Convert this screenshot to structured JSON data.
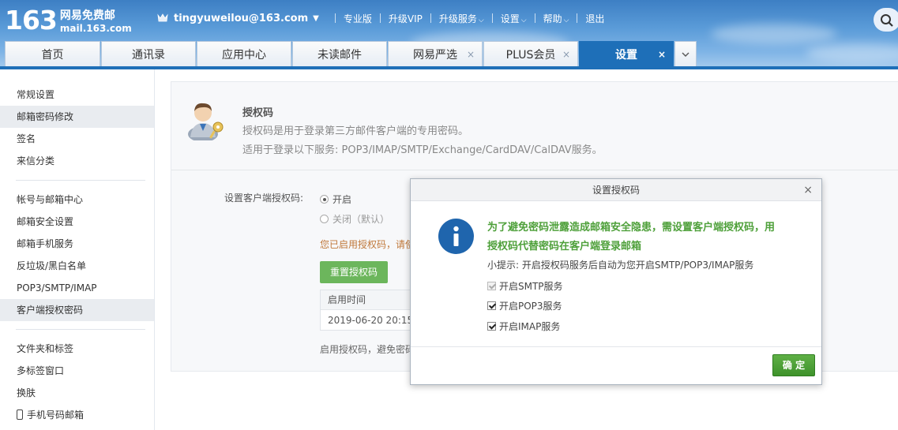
{
  "brand": {
    "logo_number": "163",
    "logo_name": "网易免费邮",
    "logo_url": "mail.163.com"
  },
  "topnav": {
    "email": "tingyuweilou@163.com",
    "links": [
      "专业版",
      "升级VIP",
      "升级服务",
      "设置",
      "帮助",
      "退出"
    ]
  },
  "tabs": [
    {
      "label": "首页",
      "closable": false
    },
    {
      "label": "通讯录",
      "closable": false
    },
    {
      "label": "应用中心",
      "closable": false
    },
    {
      "label": "未读邮件",
      "closable": false
    },
    {
      "label": "网易严选",
      "closable": true
    },
    {
      "label": "PLUS会员",
      "closable": true
    },
    {
      "label": "设置",
      "closable": true,
      "active": true
    }
  ],
  "tab_close_glyph": "×",
  "sidebar": {
    "groups": [
      [
        "常规设置",
        "邮箱密码修改",
        "签名",
        "来信分类"
      ],
      [
        "帐号与邮箱中心",
        "邮箱安全设置",
        "邮箱手机服务",
        "反垃圾/黑白名单",
        "POP3/SMTP/IMAP",
        "客户端授权密码"
      ],
      [
        "文件夹和标签",
        "多标签窗口",
        "换肤",
        "手机号码邮箱"
      ]
    ]
  },
  "panel": {
    "title": "授权码",
    "desc1": "授权码是用于登录第三方邮件客户端的专用密码。",
    "desc2": "适用于登录以下服务: POP3/IMAP/SMTP/Exchange/CardDAV/CalDAV服务。",
    "field_label": "设置客户端授权码:",
    "radio_on": "开启",
    "radio_off": "关闭（默认）",
    "enabled_note": "您已启用授权码，请使",
    "reset_button": "重置授权码",
    "table_header": "启用时间",
    "table_value": "2019-06-20 20:15:",
    "foot_note": "启用授权码，避免密码"
  },
  "modal": {
    "title": "设置授权码",
    "close": "×",
    "info_glyph": "i",
    "main_line1": "为了避免密码泄露造成邮箱安全隐患，需设置客户端授权码，用",
    "main_line2": "授权码代替密码在客户端登录邮箱",
    "tip": "小提示: 开启授权码服务后自动为您开启SMTP/POP3/IMAP服务",
    "checks": [
      "开启SMTP服务",
      "开启POP3服务",
      "开启IMAP服务"
    ],
    "ok_button": "确 定"
  },
  "colors": {
    "accent": "#1e6fb8",
    "green": "#4ea03a",
    "info": "#1f65ad"
  }
}
